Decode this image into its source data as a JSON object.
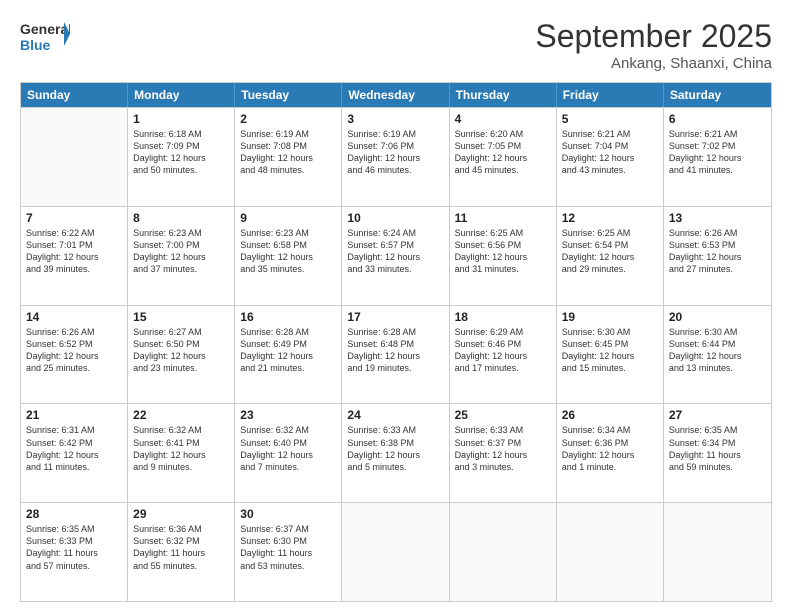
{
  "header": {
    "logo_general": "General",
    "logo_blue": "Blue",
    "month_title": "September 2025",
    "location": "Ankang, Shaanxi, China"
  },
  "days_of_week": [
    "Sunday",
    "Monday",
    "Tuesday",
    "Wednesday",
    "Thursday",
    "Friday",
    "Saturday"
  ],
  "weeks": [
    [
      {
        "day": "",
        "info": ""
      },
      {
        "day": "1",
        "info": "Sunrise: 6:18 AM\nSunset: 7:09 PM\nDaylight: 12 hours\nand 50 minutes."
      },
      {
        "day": "2",
        "info": "Sunrise: 6:19 AM\nSunset: 7:08 PM\nDaylight: 12 hours\nand 48 minutes."
      },
      {
        "day": "3",
        "info": "Sunrise: 6:19 AM\nSunset: 7:06 PM\nDaylight: 12 hours\nand 46 minutes."
      },
      {
        "day": "4",
        "info": "Sunrise: 6:20 AM\nSunset: 7:05 PM\nDaylight: 12 hours\nand 45 minutes."
      },
      {
        "day": "5",
        "info": "Sunrise: 6:21 AM\nSunset: 7:04 PM\nDaylight: 12 hours\nand 43 minutes."
      },
      {
        "day": "6",
        "info": "Sunrise: 6:21 AM\nSunset: 7:02 PM\nDaylight: 12 hours\nand 41 minutes."
      }
    ],
    [
      {
        "day": "7",
        "info": "Sunrise: 6:22 AM\nSunset: 7:01 PM\nDaylight: 12 hours\nand 39 minutes."
      },
      {
        "day": "8",
        "info": "Sunrise: 6:23 AM\nSunset: 7:00 PM\nDaylight: 12 hours\nand 37 minutes."
      },
      {
        "day": "9",
        "info": "Sunrise: 6:23 AM\nSunset: 6:58 PM\nDaylight: 12 hours\nand 35 minutes."
      },
      {
        "day": "10",
        "info": "Sunrise: 6:24 AM\nSunset: 6:57 PM\nDaylight: 12 hours\nand 33 minutes."
      },
      {
        "day": "11",
        "info": "Sunrise: 6:25 AM\nSunset: 6:56 PM\nDaylight: 12 hours\nand 31 minutes."
      },
      {
        "day": "12",
        "info": "Sunrise: 6:25 AM\nSunset: 6:54 PM\nDaylight: 12 hours\nand 29 minutes."
      },
      {
        "day": "13",
        "info": "Sunrise: 6:26 AM\nSunset: 6:53 PM\nDaylight: 12 hours\nand 27 minutes."
      }
    ],
    [
      {
        "day": "14",
        "info": "Sunrise: 6:26 AM\nSunset: 6:52 PM\nDaylight: 12 hours\nand 25 minutes."
      },
      {
        "day": "15",
        "info": "Sunrise: 6:27 AM\nSunset: 6:50 PM\nDaylight: 12 hours\nand 23 minutes."
      },
      {
        "day": "16",
        "info": "Sunrise: 6:28 AM\nSunset: 6:49 PM\nDaylight: 12 hours\nand 21 minutes."
      },
      {
        "day": "17",
        "info": "Sunrise: 6:28 AM\nSunset: 6:48 PM\nDaylight: 12 hours\nand 19 minutes."
      },
      {
        "day": "18",
        "info": "Sunrise: 6:29 AM\nSunset: 6:46 PM\nDaylight: 12 hours\nand 17 minutes."
      },
      {
        "day": "19",
        "info": "Sunrise: 6:30 AM\nSunset: 6:45 PM\nDaylight: 12 hours\nand 15 minutes."
      },
      {
        "day": "20",
        "info": "Sunrise: 6:30 AM\nSunset: 6:44 PM\nDaylight: 12 hours\nand 13 minutes."
      }
    ],
    [
      {
        "day": "21",
        "info": "Sunrise: 6:31 AM\nSunset: 6:42 PM\nDaylight: 12 hours\nand 11 minutes."
      },
      {
        "day": "22",
        "info": "Sunrise: 6:32 AM\nSunset: 6:41 PM\nDaylight: 12 hours\nand 9 minutes."
      },
      {
        "day": "23",
        "info": "Sunrise: 6:32 AM\nSunset: 6:40 PM\nDaylight: 12 hours\nand 7 minutes."
      },
      {
        "day": "24",
        "info": "Sunrise: 6:33 AM\nSunset: 6:38 PM\nDaylight: 12 hours\nand 5 minutes."
      },
      {
        "day": "25",
        "info": "Sunrise: 6:33 AM\nSunset: 6:37 PM\nDaylight: 12 hours\nand 3 minutes."
      },
      {
        "day": "26",
        "info": "Sunrise: 6:34 AM\nSunset: 6:36 PM\nDaylight: 12 hours\nand 1 minute."
      },
      {
        "day": "27",
        "info": "Sunrise: 6:35 AM\nSunset: 6:34 PM\nDaylight: 11 hours\nand 59 minutes."
      }
    ],
    [
      {
        "day": "28",
        "info": "Sunrise: 6:35 AM\nSunset: 6:33 PM\nDaylight: 11 hours\nand 57 minutes."
      },
      {
        "day": "29",
        "info": "Sunrise: 6:36 AM\nSunset: 6:32 PM\nDaylight: 11 hours\nand 55 minutes."
      },
      {
        "day": "30",
        "info": "Sunrise: 6:37 AM\nSunset: 6:30 PM\nDaylight: 11 hours\nand 53 minutes."
      },
      {
        "day": "",
        "info": ""
      },
      {
        "day": "",
        "info": ""
      },
      {
        "day": "",
        "info": ""
      },
      {
        "day": "",
        "info": ""
      }
    ]
  ]
}
